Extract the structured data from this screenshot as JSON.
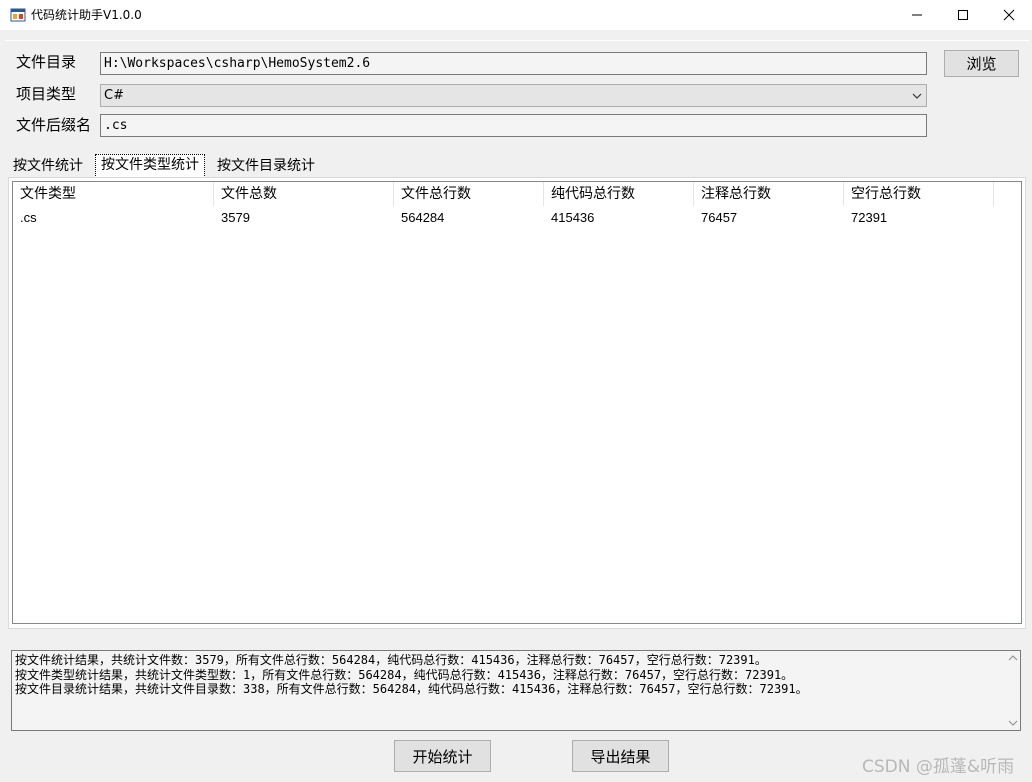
{
  "window": {
    "title": "代码统计助手V1.0.0"
  },
  "form": {
    "dir_label": "文件目录",
    "dir_value": "H:\\Workspaces\\csharp\\HemoSystem2.6",
    "type_label": "项目类型",
    "type_value": "C#",
    "ext_label": "文件后缀名",
    "ext_value": ".cs",
    "browse_label": "浏览"
  },
  "tabs": [
    {
      "label": "按文件统计",
      "active": false
    },
    {
      "label": "按文件类型统计",
      "active": true
    },
    {
      "label": "按文件目录统计",
      "active": false
    }
  ],
  "table": {
    "columns": [
      "文件类型",
      "文件总数",
      "文件总行数",
      "纯代码总行数",
      "注释总行数",
      "空行总行数"
    ],
    "rows": [
      [
        ".cs",
        "3579",
        "564284",
        "415436",
        "76457",
        "72391"
      ]
    ]
  },
  "results": [
    "按文件统计结果，共统计文件数：3579，所有文件总行数：564284，纯代码总行数：415436，注释总行数：76457，空行总行数：72391。",
    "按文件类型统计结果，共统计文件类型数：1，所有文件总行数：564284，纯代码总行数：415436，注释总行数：76457，空行总行数：72391。",
    "按文件目录统计结果，共统计文件目录数：338，所有文件总行数：564284，纯代码总行数：415436，注释总行数：76457，空行总行数：72391。"
  ],
  "buttons": {
    "start_label": "开始统计",
    "export_label": "导出结果"
  },
  "watermark": "CSDN @孤蓬&听雨",
  "colors": {
    "window_bg": "#f0f0f0",
    "button_bg": "#e1e1e1",
    "border": "#adadad"
  }
}
